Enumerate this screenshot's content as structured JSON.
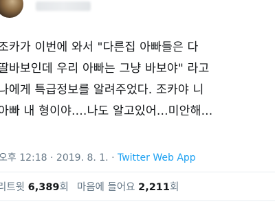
{
  "tweet": {
    "lines": [
      "조카가 이번에 와서 \"다른집 아빠들은 다",
      "딸바보인데 우리 아빠는 그냥 바보야\" 라고",
      "나에게 특급정보를 알려주었다. 조카야 니",
      "아빠 내 형이야....나도 알고있어...미안해..."
    ]
  },
  "meta": {
    "time": "오후 12:18",
    "separator": " · ",
    "date": "2019. 8. 1.",
    "source": "Twitter Web App"
  },
  "stats": {
    "retweets_label": "리트윗",
    "retweets_count": "6,389",
    "retweets_unit": "회",
    "likes_label": "마음에 들어요",
    "likes_count": "2,211",
    "likes_unit": "회"
  },
  "colors": {
    "text": "#14171a",
    "secondary": "#657786",
    "link": "#1da1f2",
    "divider": "#e6ecf0"
  }
}
